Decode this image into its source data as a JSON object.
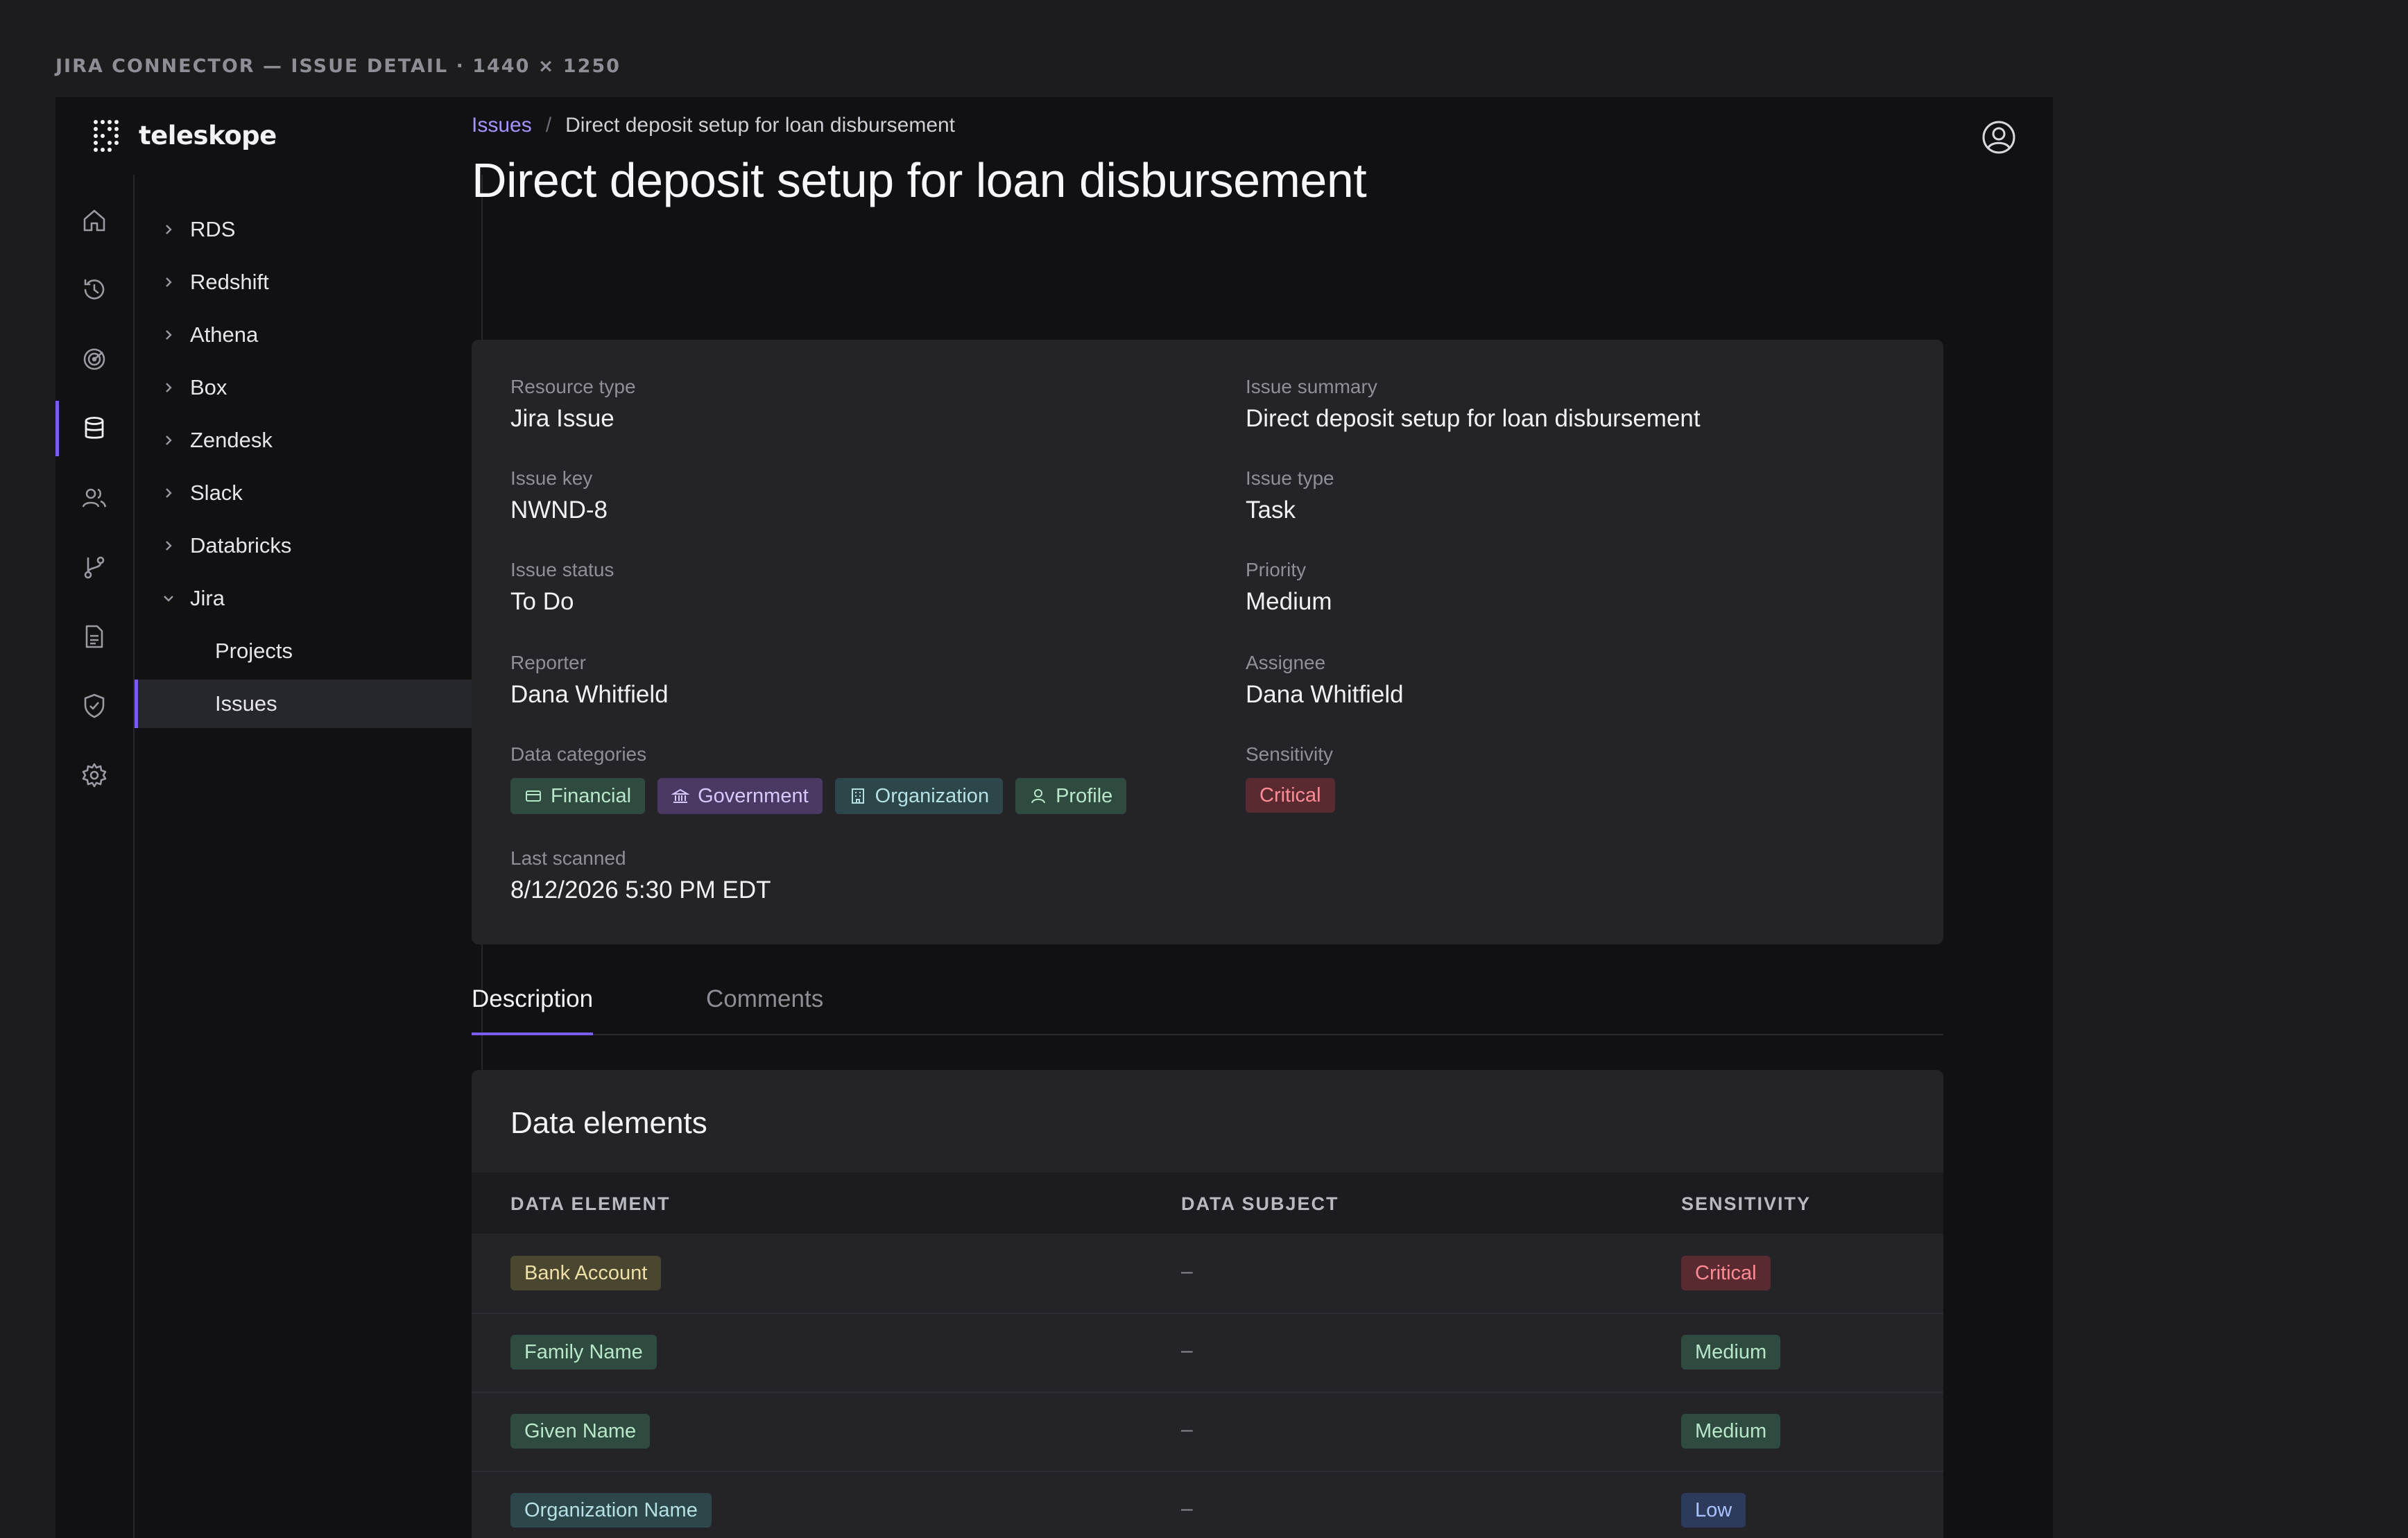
{
  "caption": "JIRA CONNECTOR — ISSUE DETAIL · 1440 × 1250",
  "app": {
    "name": "teleskope"
  },
  "colors": {
    "accent": "#7b5cf0",
    "link": "#a593ff",
    "critical": "#ff8b96",
    "medium": "#b8e6c9",
    "low": "#a9c3ff"
  },
  "rail": [
    "home-icon",
    "history-icon",
    "radar-icon",
    "database-icon",
    "users-icon",
    "git-branch-icon",
    "document-icon",
    "shield-icon",
    "gear-icon"
  ],
  "tree": {
    "items": [
      {
        "label": "RDS",
        "expanded": false
      },
      {
        "label": "Redshift",
        "expanded": false
      },
      {
        "label": "Athena",
        "expanded": false
      },
      {
        "label": "Box",
        "expanded": false
      },
      {
        "label": "Zendesk",
        "expanded": false
      },
      {
        "label": "Slack",
        "expanded": false
      },
      {
        "label": "Databricks",
        "expanded": false
      },
      {
        "label": "Jira",
        "expanded": true
      }
    ],
    "children": [
      {
        "label": "Projects",
        "selected": false
      },
      {
        "label": "Issues",
        "selected": true
      }
    ]
  },
  "breadcrumb": {
    "root": "Issues",
    "separator": "/",
    "current": "Direct deposit setup for loan disbursement"
  },
  "page_title": "Direct deposit setup for loan disbursement",
  "details": {
    "resource_type": {
      "label": "Resource type",
      "value": "Jira Issue"
    },
    "issue_summary": {
      "label": "Issue summary",
      "value": "Direct deposit setup for loan disbursement"
    },
    "issue_key": {
      "label": "Issue key",
      "value": "NWND-8"
    },
    "issue_type": {
      "label": "Issue type",
      "value": "Task"
    },
    "issue_status": {
      "label": "Issue status",
      "value": "To Do"
    },
    "priority": {
      "label": "Priority",
      "value": "Medium"
    },
    "reporter": {
      "label": "Reporter",
      "value": "Dana Whitfield"
    },
    "assignee": {
      "label": "Assignee",
      "value": "Dana Whitfield"
    },
    "data_categories": {
      "label": "Data categories",
      "items": [
        {
          "label": "Financial",
          "icon": "credit-card-icon"
        },
        {
          "label": "Government",
          "icon": "bank-icon"
        },
        {
          "label": "Organization",
          "icon": "building-icon"
        },
        {
          "label": "Profile",
          "icon": "user-icon"
        }
      ]
    },
    "sensitivity": {
      "label": "Sensitivity",
      "value": "Critical"
    },
    "last_scanned": {
      "label": "Last scanned",
      "value": "8/12/2026 5:30 PM EDT"
    }
  },
  "tabs": [
    {
      "label": "Description",
      "active": true
    },
    {
      "label": "Comments",
      "active": false
    }
  ],
  "elements": {
    "title": "Data elements",
    "columns": [
      "DATA ELEMENT",
      "DATA SUBJECT",
      "SENSITIVITY"
    ],
    "rows": [
      {
        "element": "Bank Account",
        "subject": "–",
        "sensitivity": "Critical"
      },
      {
        "element": "Family Name",
        "subject": "–",
        "sensitivity": "Medium"
      },
      {
        "element": "Given Name",
        "subject": "–",
        "sensitivity": "Medium"
      },
      {
        "element": "Organization Name",
        "subject": "–",
        "sensitivity": "Low"
      }
    ]
  }
}
